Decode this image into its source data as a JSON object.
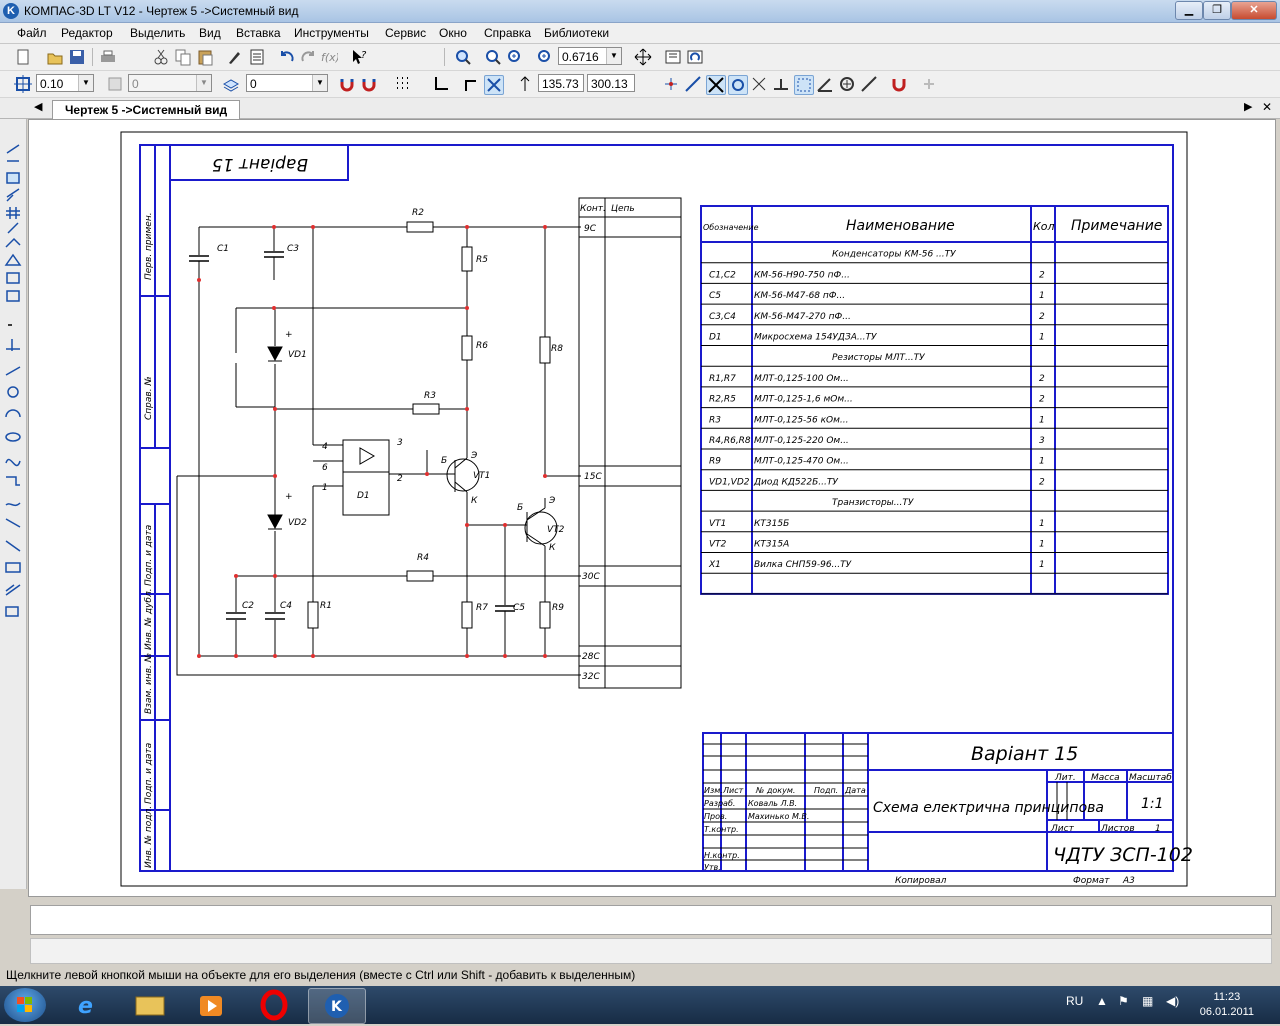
{
  "window": {
    "title": "КОМПАС-3D LT V12 - Чертеж 5 ->Системный вид",
    "icon_letter": "K"
  },
  "window_buttons": [
    "minimize-icon",
    "maximize-icon",
    "close-icon"
  ],
  "menu": [
    "Файл",
    "Редактор",
    "Выделить",
    "Вид",
    "Вставка",
    "Инструменты",
    "Сервис",
    "Окно",
    "Справка",
    "Библиотеки"
  ],
  "toolbar1": {
    "zoom_value": "0.6716"
  },
  "toolbar2": {
    "step_value": "0.10",
    "angle_value": "0",
    "layer_value": "0",
    "coord_x": "135.73",
    "coord_y": "300.13"
  },
  "doc_tab": "Чертеж 5 ->Системный вид",
  "drawing": {
    "variant_mirrored": "Варіант 15",
    "side_labels": [
      "Перв. примен.",
      "Справ. №",
      "Подп. и дата",
      "Инв. № дубл.",
      "Взам. инв. №",
      "Подп. и дата",
      "Инв. № подл."
    ],
    "components": [
      "R2",
      "R5",
      "R6",
      "R8",
      "R3",
      "R4",
      "R1",
      "R7",
      "R9",
      "C1",
      "C3",
      "C2",
      "C4",
      "C5",
      "VD1",
      "VD2",
      "D1",
      "VT1",
      "VT2"
    ],
    "pin_labels": {
      "d1_pins": [
        "4",
        "6",
        "1",
        "3",
        "2"
      ],
      "bjt": [
        "Б",
        "Э",
        "К"
      ],
      "plus": "+"
    },
    "connector": {
      "header_kont": "Конт.",
      "header_tsep": "Цепь",
      "rows": [
        "9С",
        "15С",
        "30С",
        "28С",
        "32С"
      ]
    },
    "bom": {
      "headers": [
        "Обозначение",
        "Наименование",
        "Кол",
        "Примечание"
      ],
      "rows": [
        {
          "pos": "",
          "name": "Конденсаторы КМ-56 ...ТУ",
          "qty": "",
          "section": true
        },
        {
          "pos": "С1,С2",
          "name": "КМ-56-Н90-750 пФ...",
          "qty": "2"
        },
        {
          "pos": "С5",
          "name": "КМ-56-М47-68 пФ...",
          "qty": "1"
        },
        {
          "pos": "С3,С4",
          "name": "КМ-56-М47-270 пФ...",
          "qty": "2"
        },
        {
          "pos": "D1",
          "name": "Микросхема 154УДЗА...ТУ",
          "qty": "1"
        },
        {
          "pos": "",
          "name": "Резисторы МЛТ...ТУ",
          "qty": "",
          "section": true
        },
        {
          "pos": "R1,R7",
          "name": "МЛТ-0,125-100 Ом...",
          "qty": "2"
        },
        {
          "pos": "R2,R5",
          "name": "МЛТ-0,125-1,6 мОм...",
          "qty": "2"
        },
        {
          "pos": "R3",
          "name": "МЛТ-0,125-56 кОм...",
          "qty": "1"
        },
        {
          "pos": "R4,R6,R8",
          "name": "МЛТ-0,125-220 Ом...",
          "qty": "3"
        },
        {
          "pos": "R9",
          "name": "МЛТ-0,125-470 Ом...",
          "qty": "1"
        },
        {
          "pos": "VD1,VD2",
          "name": "Диод КД522Б...ТУ",
          "qty": "2"
        },
        {
          "pos": "",
          "name": "Транзисторы...ТУ",
          "qty": "",
          "section": true
        },
        {
          "pos": "VT1",
          "name": "КТ315Б",
          "qty": "1"
        },
        {
          "pos": "VT2",
          "name": "КТ315А",
          "qty": "1"
        },
        {
          "pos": "X1",
          "name": "Вилка СНП59-96...ТУ",
          "qty": "1"
        },
        {
          "pos": "",
          "name": "",
          "qty": ""
        }
      ]
    },
    "stamp": {
      "variant": "Варіант 15",
      "doc_title": "Схема електрична принципова",
      "code": "ЧДТУ ЗСП-102",
      "scale": "1:1",
      "col_labels": [
        "Изм.",
        "Лист",
        "№ докум.",
        "Подп.",
        "Дата"
      ],
      "role_labels": [
        "Разраб.",
        "Пров.",
        "Т.контр.",
        "Н.контр.",
        "Утв."
      ],
      "razrab": "Коваль Л.В.",
      "prov": "Махинько М.В.",
      "lit": "Лит.",
      "massa": "Масса",
      "masshtab": "Масштаб",
      "list": "Лист",
      "listov": "Листов",
      "listov_val": "1",
      "kopiroval": "Копировал",
      "format": "Формат",
      "format_val": "А3"
    }
  },
  "status_hint": "Щелкните левой кнопкой мыши на объекте для его выделения (вместе с Ctrl или Shift - добавить к выделенным)",
  "tray": {
    "lang": "RU",
    "time": "11:23",
    "date": "06.01.2011"
  },
  "colors": {
    "frame_blue": "#1a1acc",
    "node_red": "#e03030",
    "window_bg": "#d4d0c8"
  }
}
